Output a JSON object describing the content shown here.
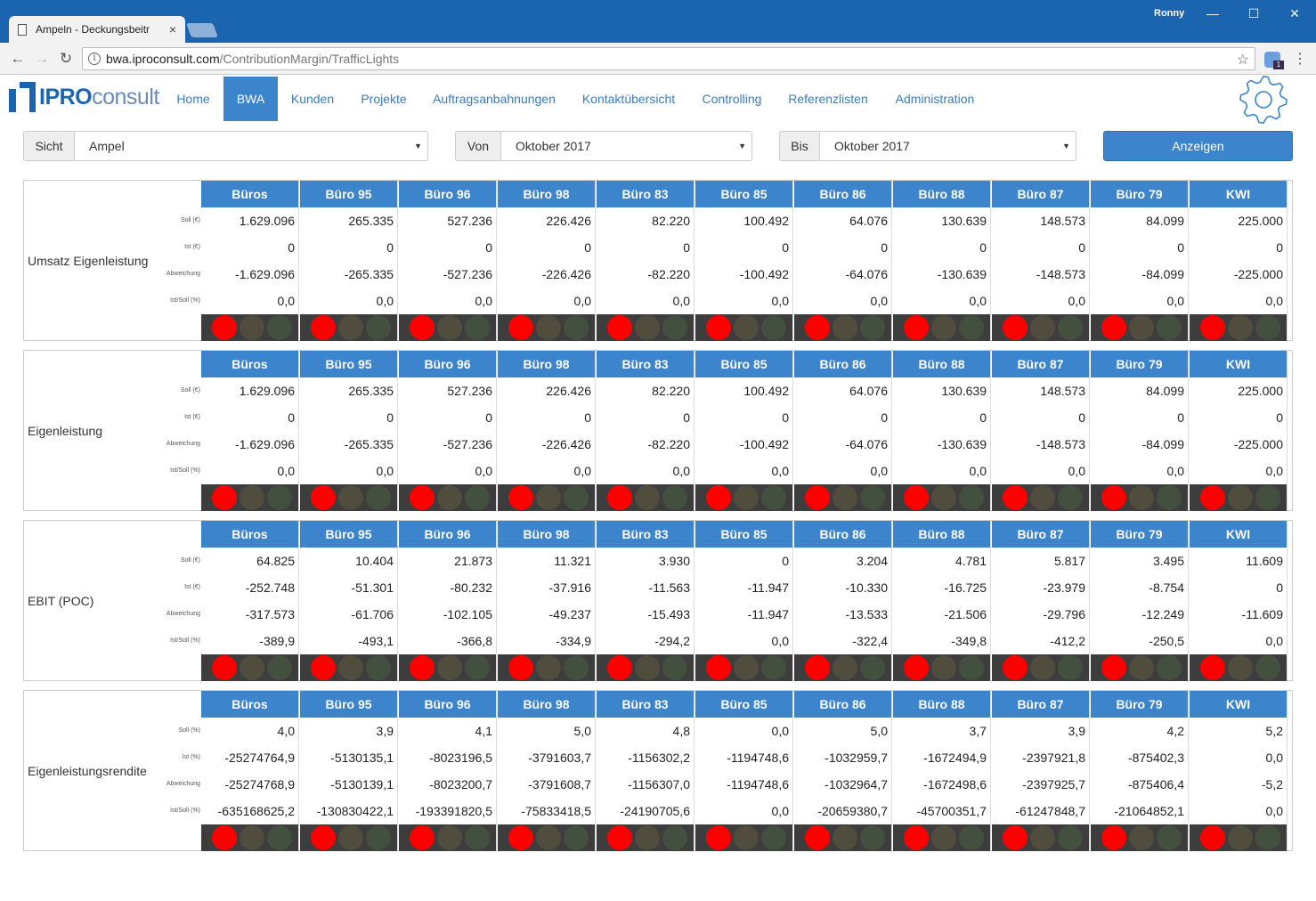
{
  "browser": {
    "tab_title": "Ampeln - Deckungsbeitr",
    "tab_close": "×",
    "user": "Ronny",
    "url_host": "bwa.iproconsult.com",
    "url_path": "/ContributionMargin/TrafficLights",
    "info_icon": "i",
    "star_icon": "☆",
    "back_icon": "←",
    "forward_icon": "→",
    "reload_icon": "↻",
    "menu_icon": "⋮",
    "minimize_icon": "—",
    "maximize_icon": "☐",
    "close_icon": "✕",
    "extension_badge": "1"
  },
  "app": {
    "logo_bold": "IPRO",
    "logo_light": "consult",
    "nav": [
      "Home",
      "BWA",
      "Kunden",
      "Projekte",
      "Auftragsanbahnungen",
      "Kontaktübersicht",
      "Controlling",
      "Referenzlisten",
      "Administration"
    ],
    "active_nav": "BWA"
  },
  "filters": {
    "sicht_label": "Sicht",
    "sicht_value": "Ampel",
    "von_label": "Von",
    "von_value": "Oktober 2017",
    "bis_label": "Bis",
    "bis_value": "Oktober 2017",
    "show_button": "Anzeigen",
    "caret": "▼"
  },
  "colors": {
    "accent": "#3c84cc",
    "titlebar": "#1a64b0",
    "light_red": "#ff0000",
    "light_off": "#504d3e",
    "light_bg": "#3d3d3d"
  },
  "columns": [
    "Büros",
    "Büro 95",
    "Büro 96",
    "Büro 98",
    "Büro 83",
    "Büro 85",
    "Büro 86",
    "Büro 88",
    "Büro 87",
    "Büro 79",
    "KWI"
  ],
  "panels": [
    {
      "title": "Umsatz Eigenleistung",
      "row_labels": [
        "Soll (€)",
        "Ist (€)",
        "Abweichung",
        "Ist/Soll (%)"
      ],
      "rows": [
        [
          "1.629.096",
          "265.335",
          "527.236",
          "226.426",
          "82.220",
          "100.492",
          "64.076",
          "130.639",
          "148.573",
          "84.099",
          "225.000"
        ],
        [
          "0",
          "0",
          "0",
          "0",
          "0",
          "0",
          "0",
          "0",
          "0",
          "0",
          "0"
        ],
        [
          "-1.629.096",
          "-265.335",
          "-527.236",
          "-226.426",
          "-82.220",
          "-100.492",
          "-64.076",
          "-130.639",
          "-148.573",
          "-84.099",
          "-225.000"
        ],
        [
          "0,0",
          "0,0",
          "0,0",
          "0,0",
          "0,0",
          "0,0",
          "0,0",
          "0,0",
          "0,0",
          "0,0",
          "0,0"
        ]
      ],
      "lights": [
        "red",
        "red",
        "red",
        "red",
        "red",
        "red",
        "red",
        "red",
        "red",
        "red",
        "red"
      ]
    },
    {
      "title": "Eigenleistung",
      "row_labels": [
        "Soll (€)",
        "Ist (€)",
        "Abweichung",
        "Ist/Soll (%)"
      ],
      "rows": [
        [
          "1.629.096",
          "265.335",
          "527.236",
          "226.426",
          "82.220",
          "100.492",
          "64.076",
          "130.639",
          "148.573",
          "84.099",
          "225.000"
        ],
        [
          "0",
          "0",
          "0",
          "0",
          "0",
          "0",
          "0",
          "0",
          "0",
          "0",
          "0"
        ],
        [
          "-1.629.096",
          "-265.335",
          "-527.236",
          "-226.426",
          "-82.220",
          "-100.492",
          "-64.076",
          "-130.639",
          "-148.573",
          "-84.099",
          "-225.000"
        ],
        [
          "0,0",
          "0,0",
          "0,0",
          "0,0",
          "0,0",
          "0,0",
          "0,0",
          "0,0",
          "0,0",
          "0,0",
          "0,0"
        ]
      ],
      "lights": [
        "red",
        "red",
        "red",
        "red",
        "red",
        "red",
        "red",
        "red",
        "red",
        "red",
        "red"
      ]
    },
    {
      "title": "EBIT (POC)",
      "row_labels": [
        "Soll (€)",
        "Ist (€)",
        "Abweichung",
        "Ist/Soll (%)"
      ],
      "rows": [
        [
          "64.825",
          "10.404",
          "21.873",
          "11.321",
          "3.930",
          "0",
          "3.204",
          "4.781",
          "5.817",
          "3.495",
          "11.609"
        ],
        [
          "-252.748",
          "-51.301",
          "-80.232",
          "-37.916",
          "-11.563",
          "-11.947",
          "-10.330",
          "-16.725",
          "-23.979",
          "-8.754",
          "0"
        ],
        [
          "-317.573",
          "-61.706",
          "-102.105",
          "-49.237",
          "-15.493",
          "-11.947",
          "-13.533",
          "-21.506",
          "-29.796",
          "-12.249",
          "-11.609"
        ],
        [
          "-389,9",
          "-493,1",
          "-366,8",
          "-334,9",
          "-294,2",
          "0,0",
          "-322,4",
          "-349,8",
          "-412,2",
          "-250,5",
          "0,0"
        ]
      ],
      "lights": [
        "red",
        "red",
        "red",
        "red",
        "red",
        "red",
        "red",
        "red",
        "red",
        "red",
        "red"
      ]
    },
    {
      "title": "Eigenleistungsrendite",
      "row_labels": [
        "Soll (%)",
        "Ist (%)",
        "Abweichung",
        "Ist/Soll (%)"
      ],
      "rows": [
        [
          "4,0",
          "3,9",
          "4,1",
          "5,0",
          "4,8",
          "0,0",
          "5,0",
          "3,7",
          "3,9",
          "4,2",
          "5,2"
        ],
        [
          "-25274764,9",
          "-5130135,1",
          "-8023196,5",
          "-3791603,7",
          "-1156302,2",
          "-1194748,6",
          "-1032959,7",
          "-1672494,9",
          "-2397921,8",
          "-875402,3",
          "0,0"
        ],
        [
          "-25274768,9",
          "-5130139,1",
          "-8023200,7",
          "-3791608,7",
          "-1156307,0",
          "-1194748,6",
          "-1032964,7",
          "-1672498,6",
          "-2397925,7",
          "-875406,4",
          "-5,2"
        ],
        [
          "-635168625,2",
          "-130830422,1",
          "-193391820,5",
          "-75833418,5",
          "-24190705,6",
          "0,0",
          "-20659380,7",
          "-45700351,7",
          "-61247848,7",
          "-21064852,1",
          "0,0"
        ]
      ],
      "lights": [
        "red",
        "red",
        "red",
        "red",
        "red",
        "red",
        "red",
        "red",
        "red",
        "red",
        "red"
      ]
    }
  ]
}
